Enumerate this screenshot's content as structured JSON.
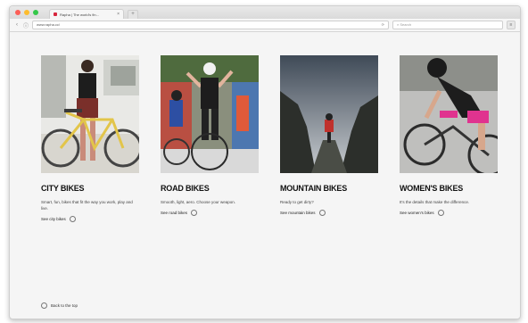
{
  "browser": {
    "tab_title": "Rapha | The world's fin...",
    "tab_close": "×",
    "new_tab": "+",
    "url": "www.rapha.cc/",
    "search_placeholder": "Search",
    "window_dots": [
      "#fc5f57",
      "#fdbc2e",
      "#34c84a"
    ]
  },
  "cards": [
    {
      "title": "CITY BIKES",
      "description": "Smart, fun, bikes that fit the way you work, play and live.",
      "link": "See city bikes"
    },
    {
      "title": "ROAD BIKES",
      "description": "Smooth, light, aero. Choose your weapon.",
      "link": "See road bikes"
    },
    {
      "title": "MOUNTAIN BIKES",
      "description": "Ready to get dirty?",
      "link": "See mountain bikes"
    },
    {
      "title": "WOMEN'S BIKES",
      "description": "It's the details that make the difference.",
      "link": "See women's bikes"
    }
  ],
  "footer": {
    "back_to_top": "Back to the top"
  }
}
